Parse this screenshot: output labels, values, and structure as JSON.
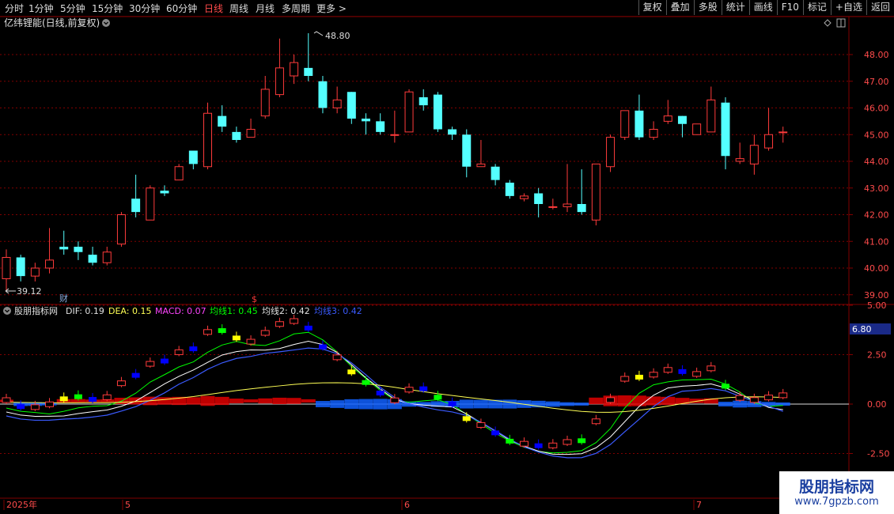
{
  "toolbar": {
    "timeframes": [
      "分时",
      "1分钟",
      "5分钟",
      "15分钟",
      "30分钟",
      "60分钟",
      "日线",
      "周线",
      "月线",
      "多周期",
      "更多 >"
    ],
    "active": "日线",
    "tools": [
      "复权",
      "叠加",
      "多股",
      "统计",
      "画线",
      "F10",
      "标记",
      "+自选",
      "返回"
    ]
  },
  "main": {
    "title": "亿纬锂能(日线,前复权)",
    "price_labels": [
      "48.00",
      "47.00",
      "46.00",
      "45.00",
      "44.00",
      "43.00",
      "42.00",
      "41.00",
      "40.00",
      "39.00"
    ],
    "high_mark": "48.80",
    "low_mark": "39.12",
    "marker_cai": "财",
    "marker_dollar": "$"
  },
  "indicator": {
    "name": "股朋指标网",
    "dif": "DIF: 0.19",
    "dea": "DEA: 0.15",
    "macd": "MACD: 0.07",
    "ma1": "均线1: 0.45",
    "ma2": "均线2: 0.42",
    "ma3": "均线3: 0.42",
    "top_value": "6.80",
    "levels": [
      "5.00",
      "2.50",
      "0.00",
      "-2.50"
    ]
  },
  "dates": {
    "year": "2025年",
    "months": [
      "5",
      "6",
      "7"
    ]
  },
  "watermark": {
    "title": "股朋指标网",
    "url": "www.7gpzb.com"
  },
  "colors": {
    "up": "#ff3b3b",
    "down": "#54ffff",
    "cyan": "#54ffff",
    "blue": "#0000ff",
    "yellow": "#ffff00",
    "green": "#00ff00",
    "grid": "#800000"
  },
  "candles": [
    [
      39.6,
      40.4,
      40.7,
      39.1
    ],
    [
      40.4,
      39.7,
      40.5,
      39.5
    ],
    [
      39.7,
      40.0,
      40.2,
      39.5
    ],
    [
      40.0,
      40.3,
      41.5,
      39.8
    ],
    [
      40.8,
      40.7,
      41.4,
      40.5
    ],
    [
      40.8,
      40.6,
      41.0,
      40.3
    ],
    [
      40.5,
      40.2,
      40.8,
      40.1
    ],
    [
      40.2,
      40.6,
      40.8,
      40.1
    ],
    [
      40.9,
      42.0,
      42.1,
      40.8
    ],
    [
      42.6,
      42.1,
      43.5,
      41.9
    ],
    [
      41.8,
      43.0,
      43.1,
      41.8
    ],
    [
      42.9,
      42.8,
      43.1,
      42.7
    ],
    [
      43.3,
      43.8,
      43.9,
      43.3
    ],
    [
      44.4,
      43.9,
      44.4,
      43.7
    ],
    [
      43.8,
      45.8,
      46.2,
      43.7
    ],
    [
      45.7,
      45.3,
      46.1,
      45.1
    ],
    [
      45.1,
      44.8,
      45.3,
      44.7
    ],
    [
      44.9,
      45.2,
      45.6,
      44.9
    ],
    [
      45.7,
      46.7,
      47.2,
      45.6
    ],
    [
      46.5,
      47.5,
      48.6,
      46.4
    ],
    [
      47.2,
      47.7,
      48.0,
      46.9
    ],
    [
      47.5,
      47.2,
      48.8,
      47.0
    ],
    [
      47.0,
      46.0,
      47.2,
      45.8
    ],
    [
      46.0,
      46.3,
      46.8,
      45.8
    ],
    [
      46.6,
      45.6,
      46.6,
      45.4
    ],
    [
      45.6,
      45.5,
      45.8,
      45.0
    ],
    [
      45.5,
      45.1,
      45.8,
      45.0
    ],
    [
      45.0,
      45.0,
      45.9,
      44.7
    ],
    [
      45.1,
      46.6,
      46.7,
      45.1
    ],
    [
      46.4,
      46.1,
      46.7,
      45.9
    ],
    [
      46.5,
      45.2,
      46.6,
      45.1
    ],
    [
      45.2,
      45.0,
      45.3,
      44.8
    ],
    [
      45.0,
      43.8,
      45.2,
      43.4
    ],
    [
      43.8,
      43.9,
      44.8,
      43.8
    ],
    [
      43.8,
      43.3,
      43.9,
      43.1
    ],
    [
      43.2,
      42.7,
      43.3,
      42.6
    ],
    [
      42.6,
      42.7,
      42.8,
      42.5
    ],
    [
      42.8,
      42.4,
      43.0,
      41.9
    ],
    [
      42.3,
      42.3,
      42.6,
      42.2
    ],
    [
      42.3,
      42.4,
      43.9,
      42.1
    ],
    [
      42.4,
      42.1,
      43.7,
      42.0
    ],
    [
      41.8,
      43.9,
      43.9,
      41.6
    ],
    [
      43.8,
      44.9,
      45.0,
      43.6
    ],
    [
      44.9,
      45.9,
      45.9,
      44.8
    ],
    [
      45.9,
      44.9,
      46.5,
      44.8
    ],
    [
      44.9,
      45.2,
      45.5,
      44.8
    ],
    [
      45.5,
      45.7,
      46.3,
      45.4
    ],
    [
      45.7,
      45.4,
      45.7,
      44.9
    ],
    [
      45.0,
      45.4,
      45.4,
      45.0
    ],
    [
      45.1,
      46.3,
      46.8,
      45.1
    ],
    [
      46.2,
      44.2,
      46.4,
      43.7
    ],
    [
      44.0,
      44.1,
      44.7,
      43.9
    ],
    [
      43.9,
      44.6,
      45.0,
      43.5
    ],
    [
      44.5,
      45.0,
      46.0,
      44.4
    ],
    [
      45.1,
      45.1,
      45.3,
      44.7
    ]
  ]
}
